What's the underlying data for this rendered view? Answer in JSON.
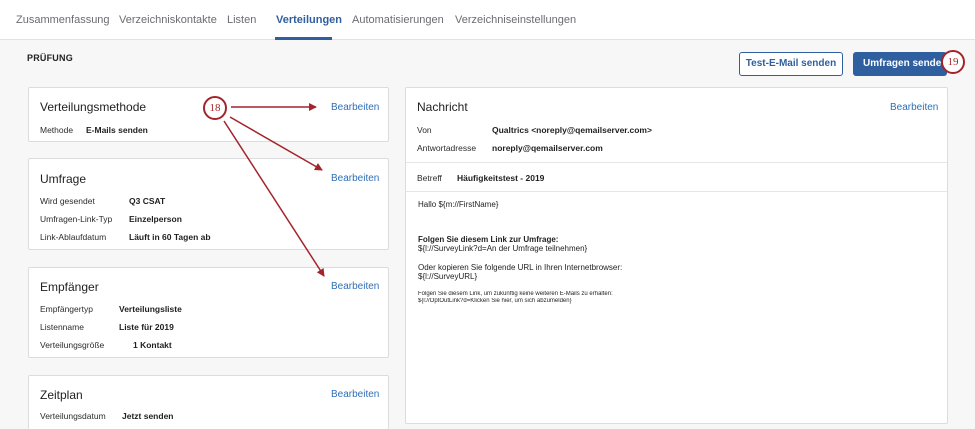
{
  "tabs": [
    {
      "label": "Zusammenfassung"
    },
    {
      "label": "Verzeichniskontakte"
    },
    {
      "label": "Listen"
    },
    {
      "label": "Verteilungen"
    },
    {
      "label": "Automatisierungen"
    },
    {
      "label": "Verzeichniseinstellungen"
    }
  ],
  "active_tab": "Verteilungen",
  "header": {
    "title": "PRÜFUNG",
    "test_email_button": "Test-E-Mail senden",
    "send_button": "Umfragen senden"
  },
  "callouts": {
    "first": "18",
    "second": "19"
  },
  "edit_label": "Bearbeiten",
  "method_card": {
    "title": "Verteilungsmethode",
    "rows": [
      {
        "label": "Methode",
        "value": "E-Mails senden"
      }
    ]
  },
  "survey_card": {
    "title": "Umfrage",
    "rows": [
      {
        "label": "Wird gesendet",
        "value": "Q3 CSAT"
      },
      {
        "label": "Umfragen-Link-Typ",
        "value": "Einzelperson"
      },
      {
        "label": "Link-Ablaufdatum",
        "value": "Läuft in 60 Tagen ab"
      }
    ]
  },
  "recipients_card": {
    "title": "Empfänger",
    "rows": [
      {
        "label": "Empfängertyp",
        "value": "Verteilungsliste"
      },
      {
        "label": "Listenname",
        "value": "Liste für 2019"
      },
      {
        "label": "Verteilungsgröße",
        "value": "1 Kontakt"
      }
    ]
  },
  "schedule_card": {
    "title": "Zeitplan",
    "rows": [
      {
        "label": "Verteilungsdatum",
        "value": "Jetzt senden"
      }
    ]
  },
  "message_card": {
    "title": "Nachricht",
    "from_label": "Von",
    "from_value": "Qualtrics <noreply@qemailserver.com>",
    "reply_label": "Antwortadresse",
    "reply_value": "noreply@qemailserver.com",
    "subject_label": "Betreff",
    "subject_value": "Häufigkeitstest - 2019",
    "body": {
      "greeting": "Hallo ${m://FirstName}",
      "follow_heading": "Folgen Sie diesem Link zur Umfrage:",
      "survey_link": "${l://SurveyLink?d=An der Umfrage teilnehmen}",
      "copy_text": "Oder kopieren Sie folgende URL in Ihren Internetbrowser:",
      "survey_url": "${l://SurveyURL}",
      "optout_text": "Folgen Sie diesem Link, um zukünftig keine weiteren E-Mails zu erhalten:",
      "optout_link": "${l://OptOutLink?d=Klicken Sie hier, um sich abzumelden}"
    }
  },
  "colors": {
    "accent": "#2f5f9f",
    "link": "#2f6fb6",
    "callout": "#a3242b"
  }
}
